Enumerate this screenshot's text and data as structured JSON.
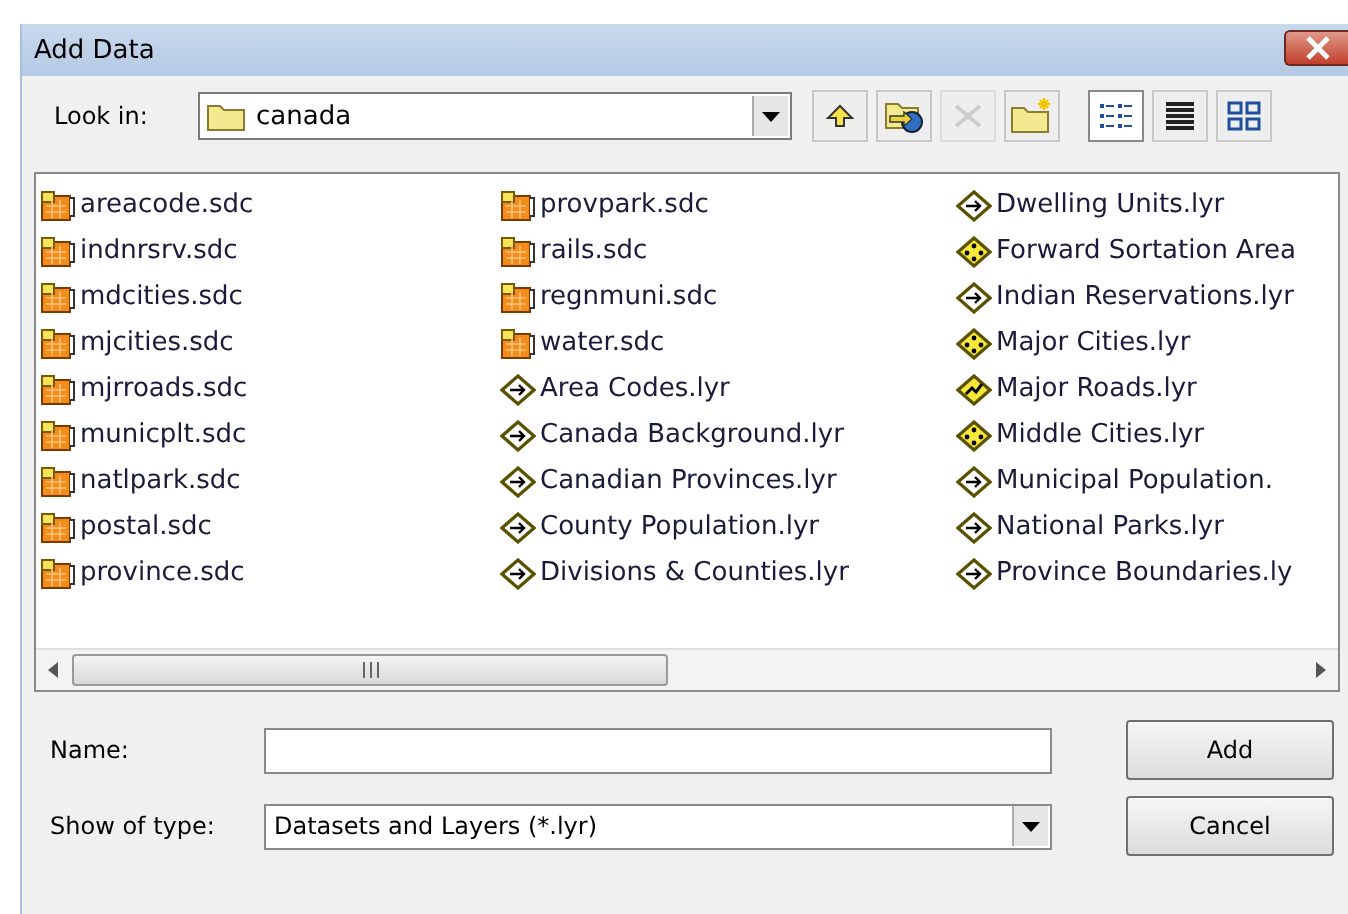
{
  "window": {
    "title": "Add Data"
  },
  "look_in": {
    "label": "Look in:",
    "value": "canada"
  },
  "toolbar": [
    {
      "kind": "up",
      "disabled": false
    },
    {
      "kind": "connect",
      "disabled": false
    },
    {
      "kind": "disconnect",
      "disabled": true
    },
    {
      "kind": "new-folder",
      "disabled": false
    }
  ],
  "views": [
    {
      "kind": "list",
      "selected": true
    },
    {
      "kind": "details",
      "selected": false
    },
    {
      "kind": "thumbnails",
      "selected": false
    }
  ],
  "files": [
    {
      "name": "areacode.sdc",
      "kind": "dataset"
    },
    {
      "name": "indnrsrv.sdc",
      "kind": "dataset"
    },
    {
      "name": "mdcities.sdc",
      "kind": "dataset"
    },
    {
      "name": "mjcities.sdc",
      "kind": "dataset"
    },
    {
      "name": "mjrroads.sdc",
      "kind": "dataset"
    },
    {
      "name": "municplt.sdc",
      "kind": "dataset"
    },
    {
      "name": "natlpark.sdc",
      "kind": "dataset"
    },
    {
      "name": "postal.sdc",
      "kind": "dataset"
    },
    {
      "name": "province.sdc",
      "kind": "dataset"
    },
    {
      "name": "provpark.sdc",
      "kind": "dataset"
    },
    {
      "name": "rails.sdc",
      "kind": "dataset"
    },
    {
      "name": "regnmuni.sdc",
      "kind": "dataset"
    },
    {
      "name": "water.sdc",
      "kind": "dataset"
    },
    {
      "name": "Area Codes.lyr",
      "kind": "layer"
    },
    {
      "name": "Canada Background.lyr",
      "kind": "layer"
    },
    {
      "name": "Canadian Provinces.lyr",
      "kind": "layer"
    },
    {
      "name": "County Population.lyr",
      "kind": "layer"
    },
    {
      "name": "Divisions & Counties.lyr",
      "kind": "layer"
    },
    {
      "name": "Dwelling Units.lyr",
      "kind": "layer"
    },
    {
      "name": "Forward Sortation Area",
      "kind": "point-layer"
    },
    {
      "name": "Indian Reservations.lyr",
      "kind": "layer"
    },
    {
      "name": "Major Cities.lyr",
      "kind": "point-layer"
    },
    {
      "name": "Major Roads.lyr",
      "kind": "road-layer"
    },
    {
      "name": "Middle Cities.lyr",
      "kind": "point-layer"
    },
    {
      "name": "Municipal Population.",
      "kind": "layer"
    },
    {
      "name": "National Parks.lyr",
      "kind": "layer"
    },
    {
      "name": "Province Boundaries.ly",
      "kind": "layer"
    }
  ],
  "name_field": {
    "label": "Name:"
  },
  "type_field": {
    "label": "Show of type:",
    "value": "Datasets and Layers (*.lyr)"
  },
  "buttons": [
    "Add",
    "Cancel"
  ]
}
